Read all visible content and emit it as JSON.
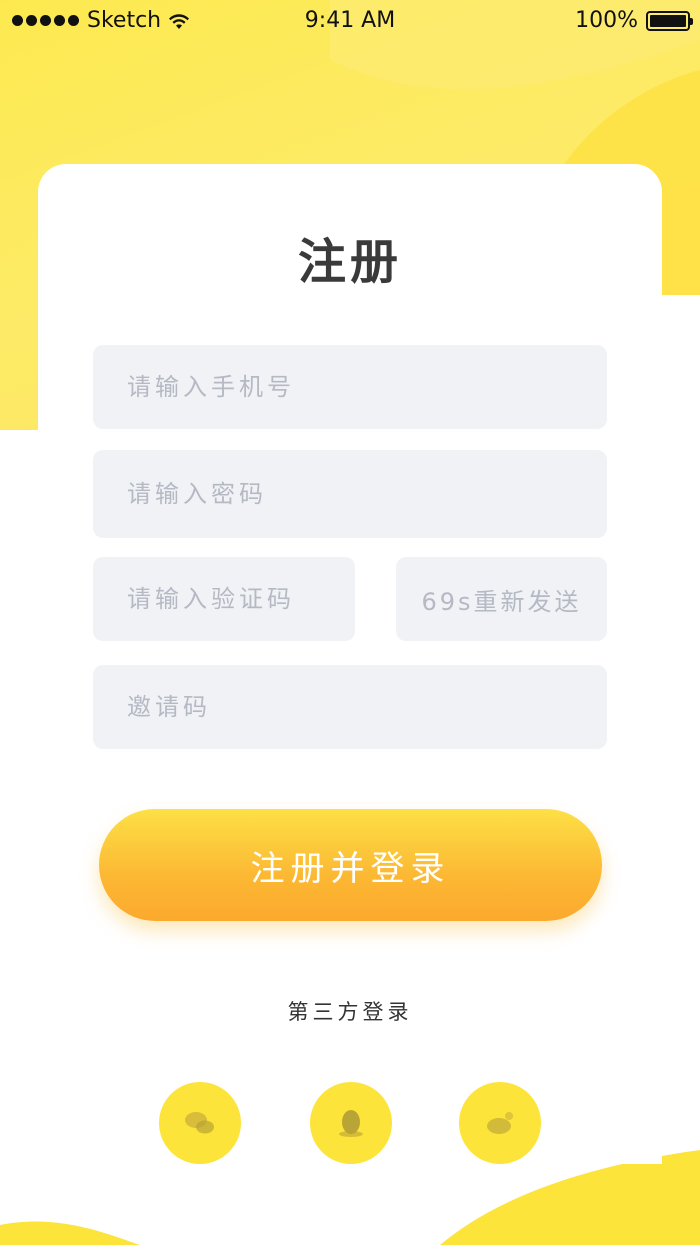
{
  "status_bar": {
    "carrier": "Sketch",
    "time": "9:41 AM",
    "battery": "100%"
  },
  "title": "注册",
  "form": {
    "phone_placeholder": "请输入手机号",
    "password_placeholder": "请输入密码",
    "code_placeholder": "请输入验证码",
    "resend_label": "69s重新发送",
    "invite_placeholder": "邀请码"
  },
  "submit_label": "注册并登录",
  "third_party": {
    "label": "第三方登录",
    "icons": [
      "wechat-icon",
      "qq-icon",
      "weibo-icon"
    ]
  },
  "colors": {
    "accent_yellow": "#fde43a",
    "button_top": "#fde046",
    "button_bottom": "#fba92d",
    "field_bg": "#f1f2f6",
    "placeholder": "#b5b9c4"
  }
}
